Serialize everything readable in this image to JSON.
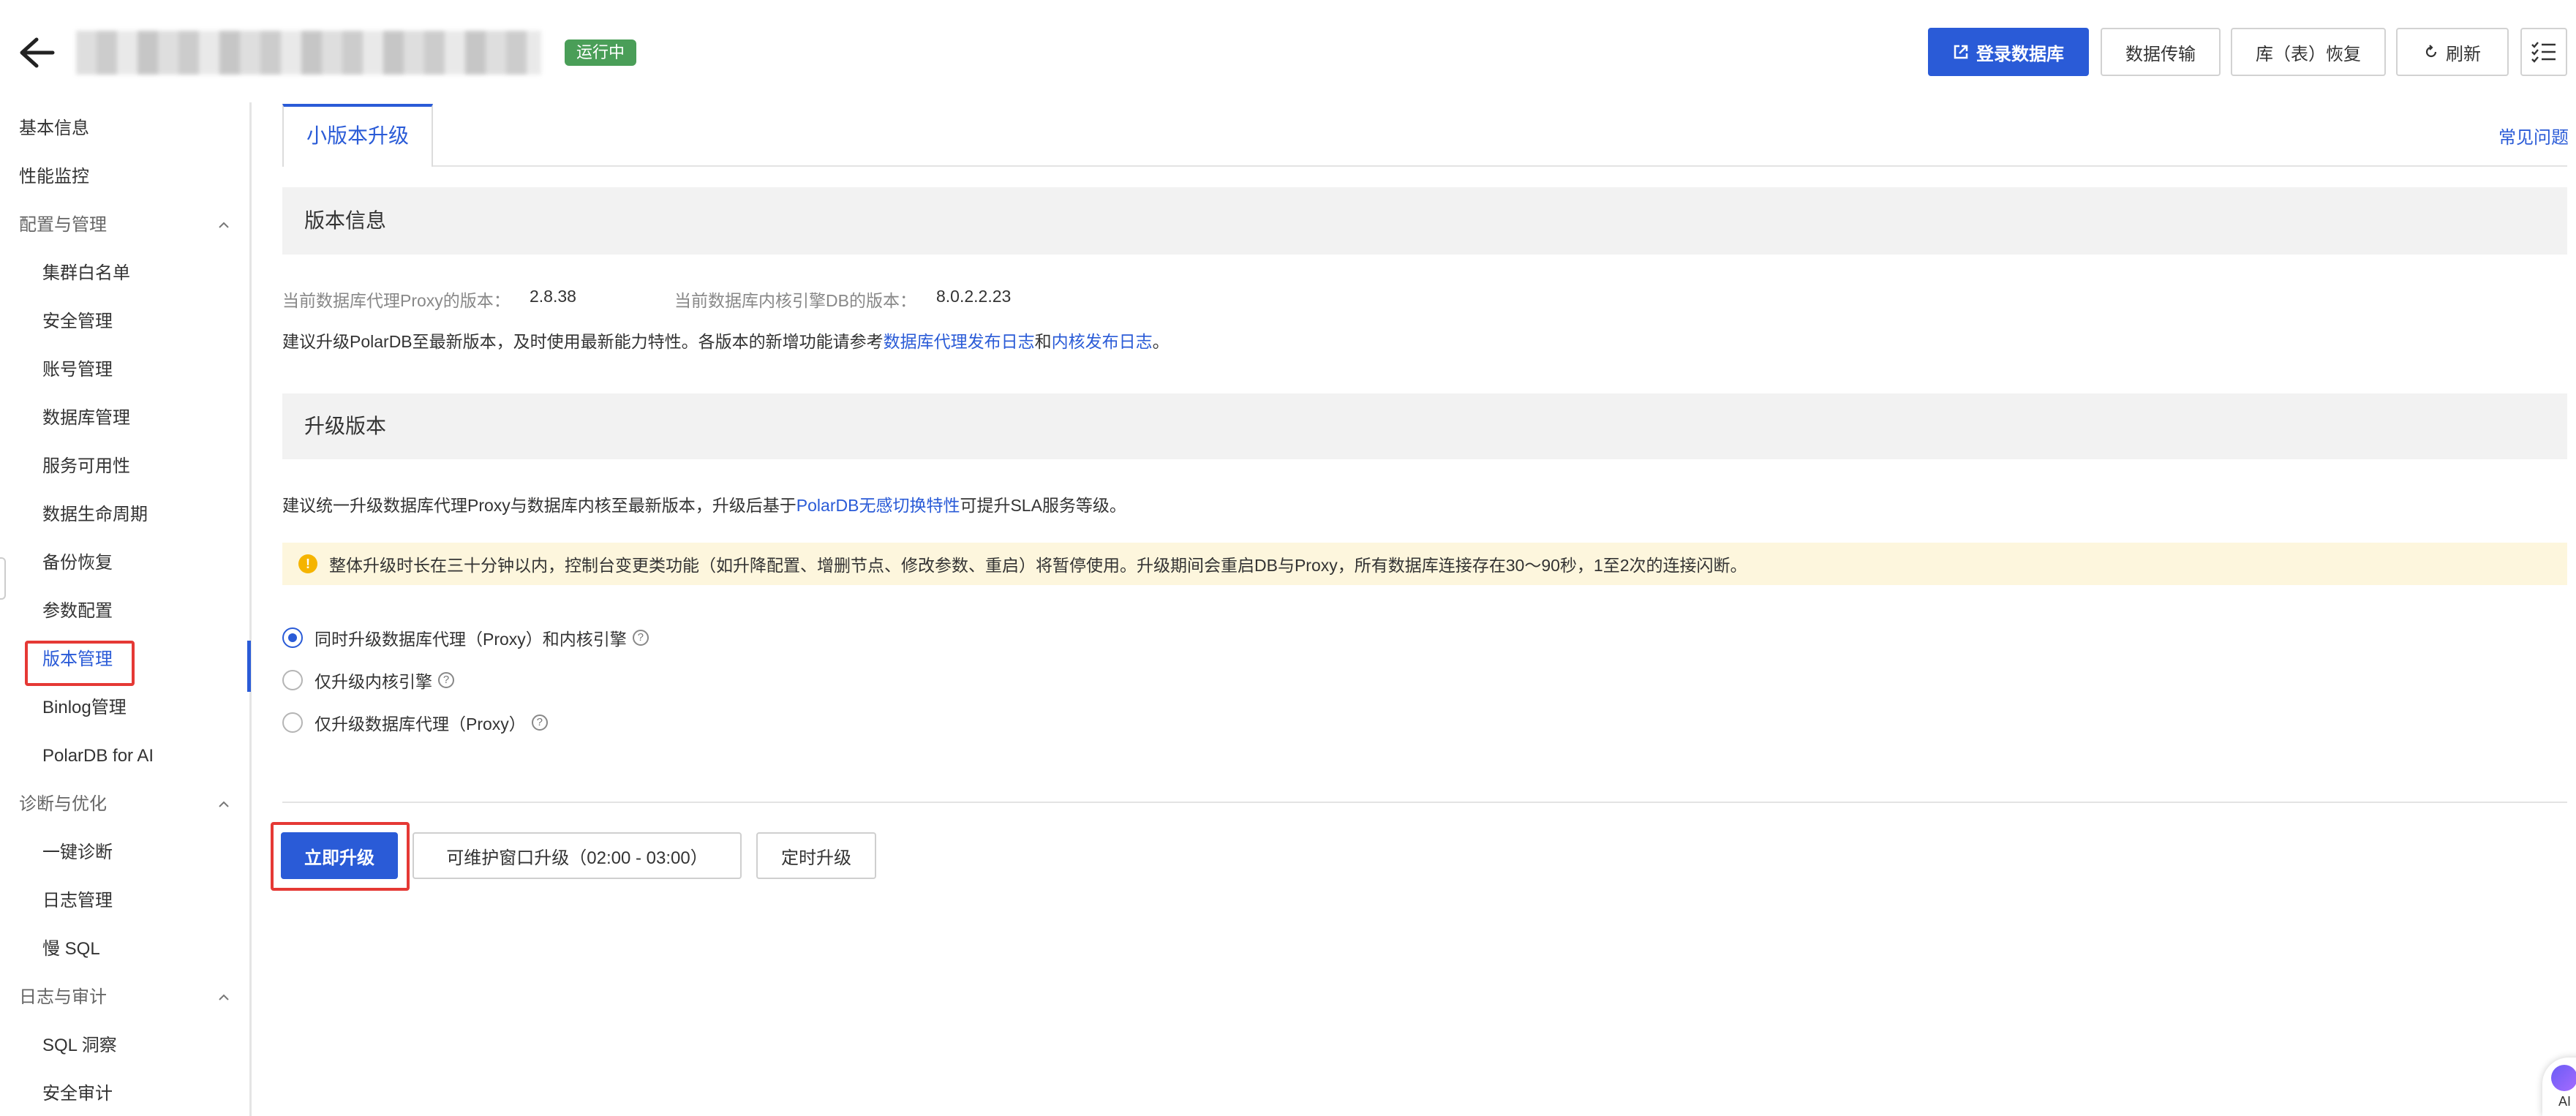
{
  "header": {
    "status_badge": "运行中",
    "buttons": {
      "login_db": "登录数据库",
      "data_transfer": "数据传输",
      "db_table_restore": "库（表）恢复",
      "refresh": "刷新"
    }
  },
  "sidebar": {
    "top_items": [
      "基本信息",
      "性能监控"
    ],
    "groups": [
      {
        "label": "配置与管理",
        "items": [
          "集群白名单",
          "安全管理",
          "账号管理",
          "数据库管理",
          "服务可用性",
          "数据生命周期",
          "备份恢复",
          "参数配置",
          "版本管理",
          "Binlog管理",
          "PolarDB for AI"
        ]
      },
      {
        "label": "诊断与优化",
        "items": [
          "一键诊断",
          "日志管理",
          "慢 SQL"
        ]
      },
      {
        "label": "日志与审计",
        "items": [
          "SQL 洞察",
          "安全审计"
        ]
      }
    ],
    "active_item": "版本管理"
  },
  "tabs": {
    "active": "小版本升级",
    "faq_link": "常见问题"
  },
  "version_info": {
    "title": "版本信息",
    "proxy_label": "当前数据库代理Proxy的版本：",
    "proxy_version": "2.8.38",
    "kernel_label": "当前数据库内核引擎DB的版本：",
    "kernel_version": "8.0.2.2.23",
    "note_prefix": "建议升级PolarDB至最新版本，及时使用最新能力特性。各版本的新增功能请参考",
    "note_link1": "数据库代理发布日志",
    "note_and": "和",
    "note_link2": "内核发布日志",
    "note_suffix": "。"
  },
  "upgrade_version": {
    "title": "升级版本",
    "note_prefix": "建议统一升级数据库代理Proxy与数据库内核至最新版本，升级后基于",
    "note_link": "PolarDB无感切换特性",
    "note_suffix": "可提升SLA服务等级。",
    "warning": "整体升级时长在三十分钟以内，控制台变更类功能（如升降配置、增删节点、修改参数、重启）将暂停使用。升级期间会重启DB与Proxy，所有数据库连接存在30～90秒，1至2次的连接闪断。",
    "options": [
      {
        "label": "同时升级数据库代理（Proxy）和内核引擎",
        "checked": true
      },
      {
        "label": "仅升级内核引擎",
        "checked": false
      },
      {
        "label": "仅升级数据库代理（Proxy）",
        "checked": false
      }
    ]
  },
  "actions": {
    "upgrade_now": "立即升级",
    "upgrade_window": "可维护窗口升级（02:00 - 03:00）",
    "scheduled_upgrade": "定时升级"
  },
  "assistant": {
    "label": "AI"
  },
  "colors": {
    "accent": "#2a5bd7",
    "status_green": "#4a9e58",
    "highlight_red": "#e53935",
    "warning_bg": "#fdf6dd"
  }
}
